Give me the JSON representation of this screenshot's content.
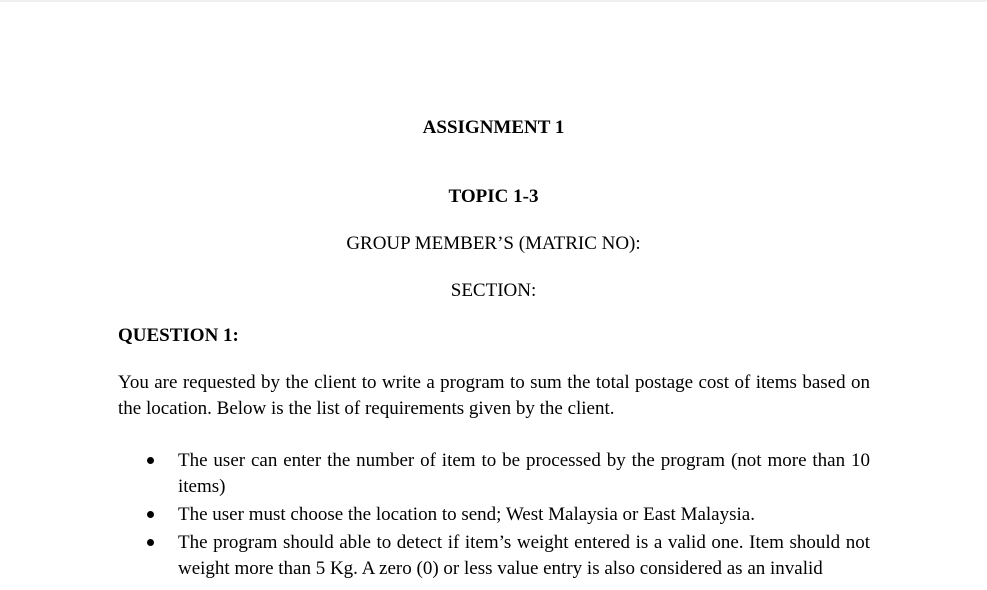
{
  "document": {
    "title": "ASSIGNMENT 1",
    "topic": "TOPIC 1-3",
    "group_members_label": "GROUP MEMBER’S (MATRIC NO):",
    "section_label": "SECTION:",
    "question_heading": "QUESTION 1:",
    "intro_paragraph": "You are requested by the client to write a program to sum the total postage cost of items based on the location. Below is the list of requirements given by the client.",
    "requirements": [
      "The user can enter the number of item to be processed by the program (not more than 10 items)",
      "The user must choose the location to send; West Malaysia or East Malaysia.",
      "The program should able to detect if item’s weight entered is a valid one. Item should not weight more than 5 Kg. A zero (0) or less value entry is also considered as an invalid"
    ]
  }
}
